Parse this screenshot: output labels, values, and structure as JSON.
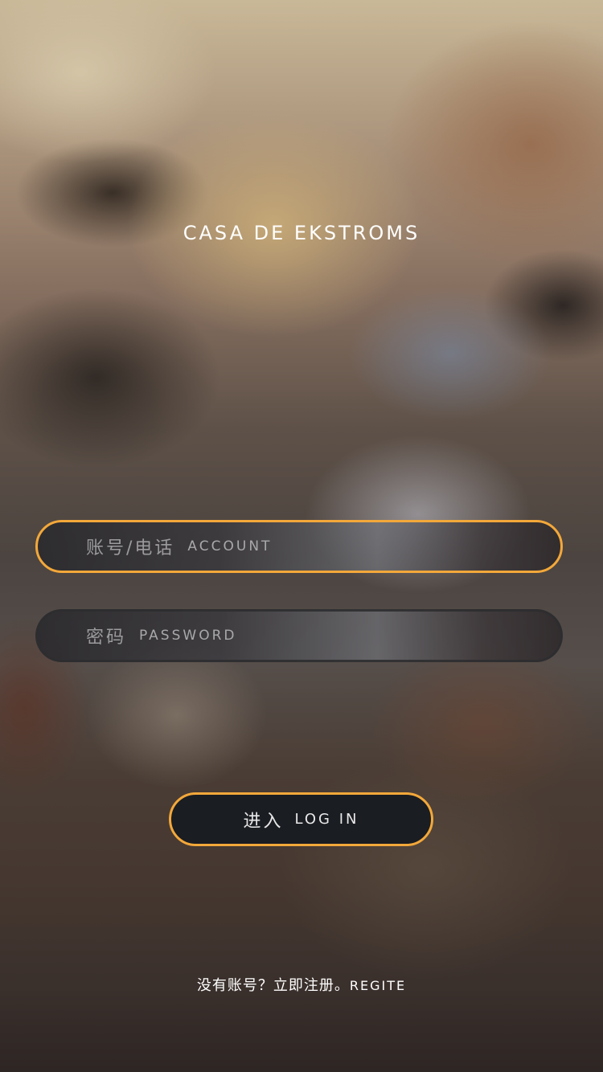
{
  "app": {
    "title": "CASA DE EKSTROMS"
  },
  "form": {
    "account": {
      "placeholder_cn": "账号/电话",
      "placeholder_en": "ACCOUNT",
      "value": ""
    },
    "password": {
      "placeholder_cn": "密码",
      "placeholder_en": "PASSWORD",
      "value": ""
    },
    "login_button": {
      "label_cn": "进入",
      "label_en": "LOG IN"
    }
  },
  "footer": {
    "prompt_cn": "没有账号？立即注册。",
    "register_link": "REGITE"
  },
  "colors": {
    "accent": "#f3a83a",
    "button_bg": "#1a1d22",
    "text": "#ffffff"
  }
}
